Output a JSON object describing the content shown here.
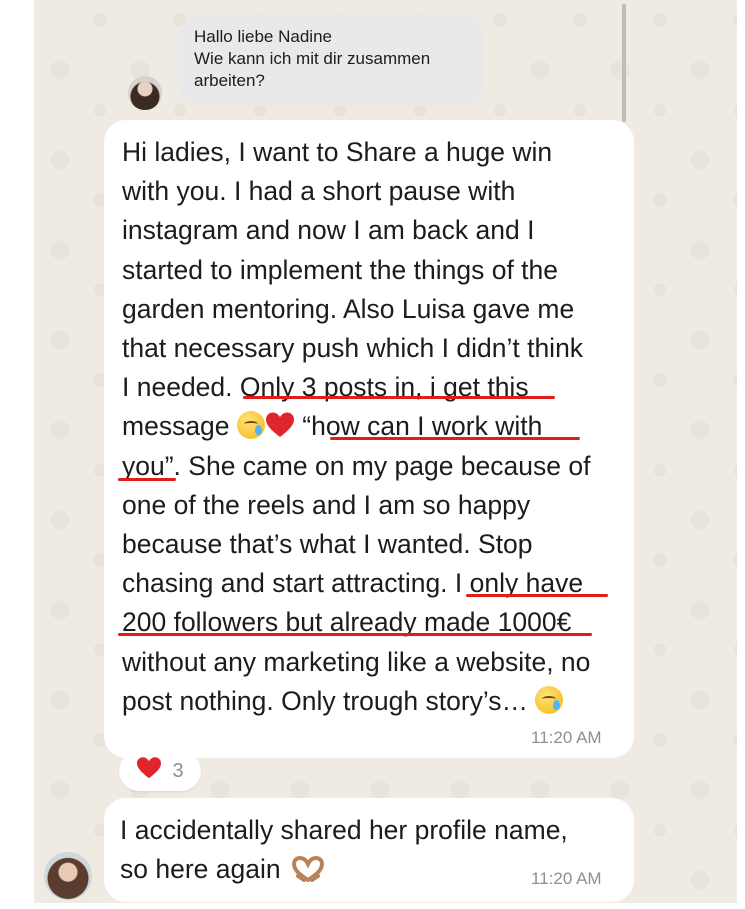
{
  "reply_quote": {
    "lines": [
      "Hallo liebe Nadine",
      "Wie kann ich mit dir zusammen",
      "arbeiten?"
    ]
  },
  "main_message": {
    "lines": [
      "Hi ladies,  I want to Share a huge win",
      "with you. I had a short pause with",
      "instagram and now I am back and I",
      "started to implement the things of the",
      "garden mentoring. Also Luisa gave me",
      "that necessary push which I didn’t think",
      "I needed. Only 3 posts in, i get this",
      "message",
      "“how can I work with",
      "you”. She came on my page because of",
      "one of the reels and I am so happy",
      "because that’s what I wanted. Stop",
      "chasing and start attracting. I only have",
      "200 followers but already made 1000€",
      "without any marketing like a website, no",
      "post nothing. Only trough story’s…"
    ],
    "timestamp": "11:20 AM"
  },
  "reaction": {
    "emoji": "heart-icon",
    "count": "3"
  },
  "second_message": {
    "lines": [
      "I accidentally shared her profile name,",
      "so here again"
    ],
    "timestamp": "11:20 AM"
  },
  "colors": {
    "underline": "#e21b1b",
    "chat_background": "#efebe3",
    "bubble": "#ffffff",
    "quote_bubble": "#e9e9eb",
    "timestamp": "#8e8e93"
  }
}
